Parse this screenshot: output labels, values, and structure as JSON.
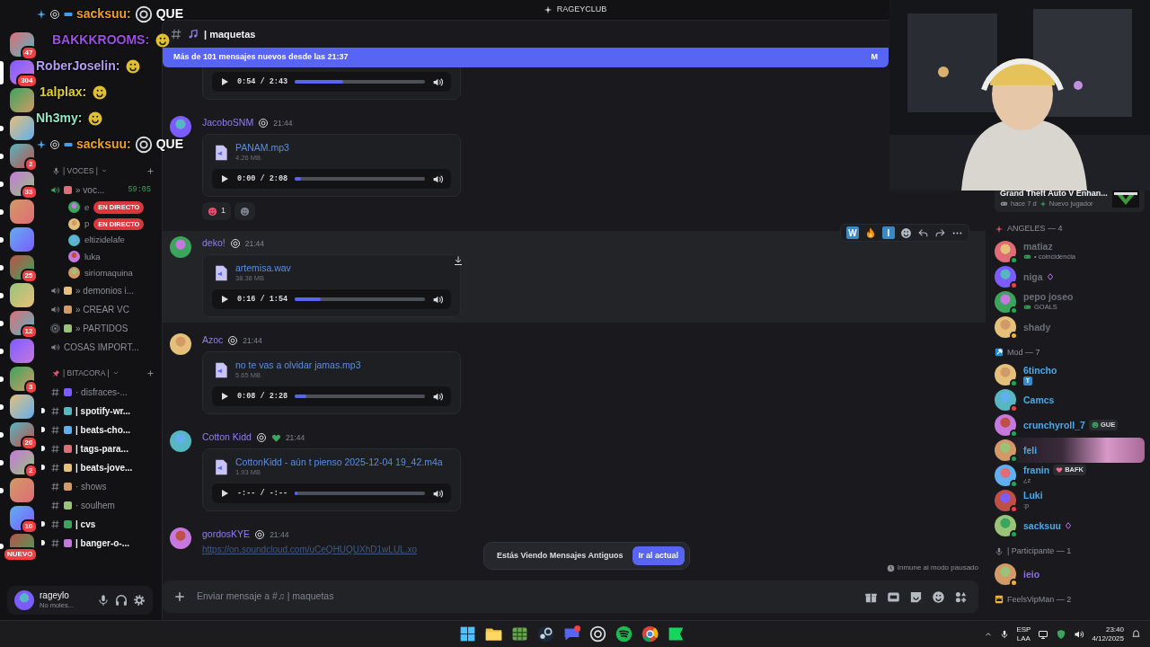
{
  "title_bar": {
    "title": "RAGEYCLUB"
  },
  "stream_chat": [
    {
      "user": "sacksuu:",
      "color": "#f0a020",
      "badges": true,
      "text": "QUE"
    },
    {
      "user": "BAKKKROOMS:",
      "color": "#a04ee8",
      "badges": false
    },
    {
      "user": "RoberJoselin:",
      "color": "#b49cf5",
      "badges": false
    },
    {
      "user": "1alplax:",
      "color": "#e0d030",
      "badges": false
    },
    {
      "user": "Nh3my:",
      "color": "#8ce8c8",
      "badges": false
    },
    {
      "user": "sacksuu:",
      "color": "#f0a020",
      "badges": true,
      "text": "QUE"
    }
  ],
  "servers": [
    {
      "badge": "47",
      "unread": false,
      "selected": false
    },
    {
      "badge": "304",
      "unread": false,
      "selected": true
    },
    {
      "unread": false,
      "selected": false
    },
    {
      "unread": true,
      "selected": false
    },
    {
      "badge": "2",
      "unread": true,
      "selected": false
    },
    {
      "badge": "33",
      "unread": true,
      "selected": false
    },
    {
      "unread": true,
      "selected": false
    },
    {
      "unread": true,
      "selected": false
    },
    {
      "badge": "25",
      "unread": true,
      "selected": false
    },
    {
      "unread": true,
      "selected": false
    },
    {
      "badge": "12",
      "unread": true,
      "selected": false
    },
    {
      "unread": true,
      "selected": false
    },
    {
      "badge": "3",
      "unread": true,
      "selected": false
    },
    {
      "unread": true,
      "selected": false
    },
    {
      "badge": "20",
      "unread": true,
      "selected": false
    },
    {
      "badge": "2",
      "unread": true,
      "selected": false
    },
    {
      "unread": true,
      "selected": false
    },
    {
      "badge": "10",
      "unread": false,
      "selected": false
    },
    {
      "badge": "NUEVO",
      "unread": true,
      "selected": false
    }
  ],
  "channel_sections": [
    {
      "title": "| VOCES |",
      "kind": "voice",
      "channels": [
        {
          "name": "» voc...",
          "kind": "voice",
          "active": true,
          "timer": "59:05",
          "members": [
            {
              "name": "e",
              "live": "EN DIRECTO"
            },
            {
              "name": "p",
              "live": "EN DIRECTO"
            },
            {
              "name": "eltizidelafe"
            },
            {
              "name": "luka"
            },
            {
              "name": "siriomaquina"
            }
          ]
        },
        {
          "name": "» demonios i...",
          "kind": "voice",
          "active": false
        },
        {
          "name": "» CREAR VC",
          "kind": "voice",
          "active": false
        },
        {
          "name": "» PARTIDOS",
          "kind": "stage",
          "active": false
        },
        {
          "name": "COSAS IMPORT...",
          "kind": "voice",
          "active": false
        }
      ]
    },
    {
      "title": "| BITACORA |",
      "kind": "pin",
      "channels": [
        {
          "name": "· disfraces-...",
          "kind": "text",
          "unread": false
        },
        {
          "name": "| spotify-wr...",
          "kind": "text",
          "unread": true
        },
        {
          "name": "| beats-cho...",
          "kind": "text",
          "unread": true
        },
        {
          "name": "| tags-para...",
          "kind": "text",
          "unread": true
        },
        {
          "name": "| beats-jove...",
          "kind": "text",
          "unread": true
        },
        {
          "name": "· shows",
          "kind": "text",
          "unread": false
        },
        {
          "name": "· soulhem",
          "kind": "text",
          "unread": false
        },
        {
          "name": "| cvs",
          "kind": "text",
          "unread": true
        },
        {
          "name": "| banger-o-...",
          "kind": "text",
          "unread": true
        }
      ]
    }
  ],
  "user_panel": {
    "name": "rageylo",
    "status": "No moles..."
  },
  "channel_header": {
    "name": "| maquetas"
  },
  "new_messages_banner": {
    "text": "Más de 101 mensajes nuevos desde las 21:37",
    "action": "M"
  },
  "messages": [
    {
      "kind": "continuation",
      "player_time": "0:54 / 2:43",
      "level": 0.37
    },
    {
      "kind": "audio",
      "author": "JacoboSNM",
      "time": "21:44",
      "hovered": false,
      "file": "PANAM.mp3",
      "size": "4.26 MB",
      "player_time": "0:00 / 2:08",
      "level": 0.05,
      "reactions": [
        {
          "count": "1"
        }
      ]
    },
    {
      "kind": "audio",
      "author": "deko!",
      "time": "21:44",
      "hovered": true,
      "file": "artemisa.wav",
      "size": "38.38 MB",
      "player_time": "0:16 / 1:54",
      "level": 0.2,
      "toolbar": [
        {
          "kind": "letter",
          "text": "W"
        },
        {
          "kind": "fire"
        },
        {
          "kind": "letter",
          "text": "I"
        }
      ]
    },
    {
      "kind": "audio",
      "author": "Azoc",
      "time": "21:44",
      "hovered": false,
      "file": "no te vas a olvidar jamas.mp3",
      "size": "5.65 MB",
      "player_time": "0:08 / 2:28",
      "level": 0.09
    },
    {
      "kind": "audio",
      "author": "Cotton Kidd",
      "time": "21:44",
      "hovered": false,
      "file": "CottonKidd - aún t pienso 2025-12-04 19_42.m4a",
      "size": "1.93 MB",
      "player_time": "-:-- / -:--",
      "level": 0.02
    },
    {
      "kind": "link",
      "author": "gordosKYE",
      "time": "21:44",
      "link": "https://on.soundcloud.com/uCeQHUQUXhD1wLUL.xo"
    }
  ],
  "old_messages_popup": {
    "text": "Estás Viendo Mensajes Antiguos",
    "button": "Ir al actual"
  },
  "slowmode_note": "Inmune al modo pausado",
  "composer": {
    "placeholder": "Enviar mensaje a #♫ | maquetas"
  },
  "activity_card": {
    "title": "Grand Theft Auto V Enhan...",
    "time": "hace 7 d",
    "status": "Nuevo jugador"
  },
  "member_groups": [
    {
      "title": "ANGELES — 4",
      "kind": "angel",
      "members": [
        {
          "name": "matiaz",
          "status": {
            "color": "#23a55a"
          },
          "activity": "• coincidencia",
          "game_activity": true
        },
        {
          "name": "niga",
          "status": {
            "color": "#f23f43"
          },
          "booster": true
        },
        {
          "name": "pepo joseo",
          "status": {
            "color": "#23a55a"
          },
          "activity": "GOALS",
          "game_activity": true
        },
        {
          "name": "shady",
          "status": {
            "color": "#f0b232"
          }
        }
      ]
    },
    {
      "title": "Mod — 7",
      "kind": "mod",
      "members": [
        {
          "name": "6tincho",
          "status": {
            "color": "#23a55a"
          },
          "badge_letter": "T"
        },
        {
          "name": "Camcs",
          "status": {
            "color": "#f23f43"
          }
        },
        {
          "name": "crunchyroll_7",
          "status": {
            "color": "#23a55a"
          },
          "tag": {
            "text": "GUE",
            "color": "#3ba55d"
          }
        },
        {
          "name": "feli",
          "status": {
            "color": "#23a55a"
          },
          "nameplate": true
        },
        {
          "name": "franin",
          "status": {
            "color": "#23a55a"
          },
          "tag": {
            "text": "BAFK",
            "color": "#f07090"
          },
          "activity": "¿z",
          "game_activity": false
        },
        {
          "name": "Luki",
          "status": {
            "color": "#f23f43"
          },
          "activity": ":p",
          "game_activity": false
        },
        {
          "name": "sacksuu",
          "status": {
            "color": "#23a55a"
          },
          "booster": true
        }
      ]
    },
    {
      "title": "| Participante — 1",
      "kind": "mic",
      "members": [
        {
          "name": "ieio",
          "status": {
            "color": "#f0b232"
          }
        }
      ]
    },
    {
      "title": "FeelsVipMan — 2",
      "kind": "crown"
    }
  ],
  "taskbar": {
    "language": "ESP",
    "layout": "LAA",
    "clock": "23:40",
    "date": "4/12/2025"
  }
}
